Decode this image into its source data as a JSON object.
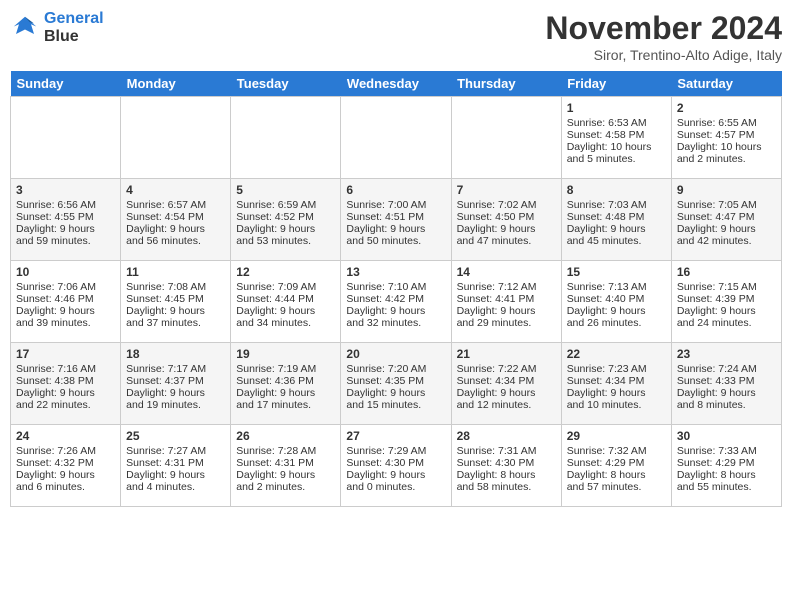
{
  "header": {
    "logo_line1": "General",
    "logo_line2": "Blue",
    "month_title": "November 2024",
    "location": "Siror, Trentino-Alto Adige, Italy"
  },
  "days_of_week": [
    "Sunday",
    "Monday",
    "Tuesday",
    "Wednesday",
    "Thursday",
    "Friday",
    "Saturday"
  ],
  "weeks": [
    [
      {
        "day": "",
        "info": ""
      },
      {
        "day": "",
        "info": ""
      },
      {
        "day": "",
        "info": ""
      },
      {
        "day": "",
        "info": ""
      },
      {
        "day": "",
        "info": ""
      },
      {
        "day": "1",
        "info": "Sunrise: 6:53 AM\nSunset: 4:58 PM\nDaylight: 10 hours and 5 minutes."
      },
      {
        "day": "2",
        "info": "Sunrise: 6:55 AM\nSunset: 4:57 PM\nDaylight: 10 hours and 2 minutes."
      }
    ],
    [
      {
        "day": "3",
        "info": "Sunrise: 6:56 AM\nSunset: 4:55 PM\nDaylight: 9 hours and 59 minutes."
      },
      {
        "day": "4",
        "info": "Sunrise: 6:57 AM\nSunset: 4:54 PM\nDaylight: 9 hours and 56 minutes."
      },
      {
        "day": "5",
        "info": "Sunrise: 6:59 AM\nSunset: 4:52 PM\nDaylight: 9 hours and 53 minutes."
      },
      {
        "day": "6",
        "info": "Sunrise: 7:00 AM\nSunset: 4:51 PM\nDaylight: 9 hours and 50 minutes."
      },
      {
        "day": "7",
        "info": "Sunrise: 7:02 AM\nSunset: 4:50 PM\nDaylight: 9 hours and 47 minutes."
      },
      {
        "day": "8",
        "info": "Sunrise: 7:03 AM\nSunset: 4:48 PM\nDaylight: 9 hours and 45 minutes."
      },
      {
        "day": "9",
        "info": "Sunrise: 7:05 AM\nSunset: 4:47 PM\nDaylight: 9 hours and 42 minutes."
      }
    ],
    [
      {
        "day": "10",
        "info": "Sunrise: 7:06 AM\nSunset: 4:46 PM\nDaylight: 9 hours and 39 minutes."
      },
      {
        "day": "11",
        "info": "Sunrise: 7:08 AM\nSunset: 4:45 PM\nDaylight: 9 hours and 37 minutes."
      },
      {
        "day": "12",
        "info": "Sunrise: 7:09 AM\nSunset: 4:44 PM\nDaylight: 9 hours and 34 minutes."
      },
      {
        "day": "13",
        "info": "Sunrise: 7:10 AM\nSunset: 4:42 PM\nDaylight: 9 hours and 32 minutes."
      },
      {
        "day": "14",
        "info": "Sunrise: 7:12 AM\nSunset: 4:41 PM\nDaylight: 9 hours and 29 minutes."
      },
      {
        "day": "15",
        "info": "Sunrise: 7:13 AM\nSunset: 4:40 PM\nDaylight: 9 hours and 26 minutes."
      },
      {
        "day": "16",
        "info": "Sunrise: 7:15 AM\nSunset: 4:39 PM\nDaylight: 9 hours and 24 minutes."
      }
    ],
    [
      {
        "day": "17",
        "info": "Sunrise: 7:16 AM\nSunset: 4:38 PM\nDaylight: 9 hours and 22 minutes."
      },
      {
        "day": "18",
        "info": "Sunrise: 7:17 AM\nSunset: 4:37 PM\nDaylight: 9 hours and 19 minutes."
      },
      {
        "day": "19",
        "info": "Sunrise: 7:19 AM\nSunset: 4:36 PM\nDaylight: 9 hours and 17 minutes."
      },
      {
        "day": "20",
        "info": "Sunrise: 7:20 AM\nSunset: 4:35 PM\nDaylight: 9 hours and 15 minutes."
      },
      {
        "day": "21",
        "info": "Sunrise: 7:22 AM\nSunset: 4:34 PM\nDaylight: 9 hours and 12 minutes."
      },
      {
        "day": "22",
        "info": "Sunrise: 7:23 AM\nSunset: 4:34 PM\nDaylight: 9 hours and 10 minutes."
      },
      {
        "day": "23",
        "info": "Sunrise: 7:24 AM\nSunset: 4:33 PM\nDaylight: 9 hours and 8 minutes."
      }
    ],
    [
      {
        "day": "24",
        "info": "Sunrise: 7:26 AM\nSunset: 4:32 PM\nDaylight: 9 hours and 6 minutes."
      },
      {
        "day": "25",
        "info": "Sunrise: 7:27 AM\nSunset: 4:31 PM\nDaylight: 9 hours and 4 minutes."
      },
      {
        "day": "26",
        "info": "Sunrise: 7:28 AM\nSunset: 4:31 PM\nDaylight: 9 hours and 2 minutes."
      },
      {
        "day": "27",
        "info": "Sunrise: 7:29 AM\nSunset: 4:30 PM\nDaylight: 9 hours and 0 minutes."
      },
      {
        "day": "28",
        "info": "Sunrise: 7:31 AM\nSunset: 4:30 PM\nDaylight: 8 hours and 58 minutes."
      },
      {
        "day": "29",
        "info": "Sunrise: 7:32 AM\nSunset: 4:29 PM\nDaylight: 8 hours and 57 minutes."
      },
      {
        "day": "30",
        "info": "Sunrise: 7:33 AM\nSunset: 4:29 PM\nDaylight: 8 hours and 55 minutes."
      }
    ]
  ]
}
